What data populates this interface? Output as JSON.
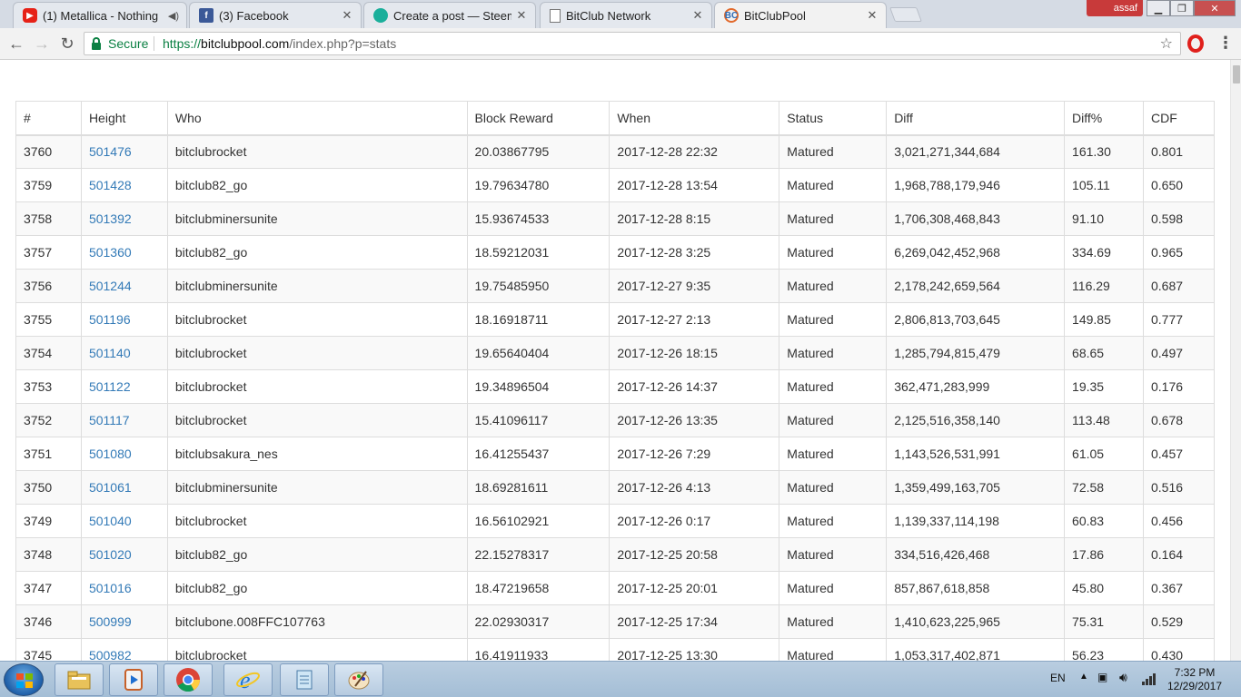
{
  "tabs": [
    {
      "title": "(1) Metallica - Nothing",
      "icon": "youtube-icon",
      "muted": true
    },
    {
      "title": "(3) Facebook",
      "icon": "facebook-icon"
    },
    {
      "title": "Create a post — Steemit",
      "icon": "steemit-icon"
    },
    {
      "title": "BitClub Network",
      "icon": "document-icon"
    },
    {
      "title": "BitClubPool",
      "icon": "bitclub-icon",
      "active": true
    }
  ],
  "window": {
    "user": "assaf"
  },
  "omnibox": {
    "secure_label": "Secure",
    "url_scheme": "https://",
    "url_host": "bitclubpool.com",
    "url_path": "/index.php?p=stats"
  },
  "table": {
    "headers": [
      "#",
      "Height",
      "Who",
      "Block Reward",
      "When",
      "Status",
      "Diff",
      "Diff%",
      "CDF"
    ],
    "rows": [
      [
        "3760",
        "501476",
        "bitclubrocket",
        "20.03867795",
        "2017-12-28 22:32",
        "Matured",
        "3,021,271,344,684",
        "161.30",
        "0.801"
      ],
      [
        "3759",
        "501428",
        "bitclub82_go",
        "19.79634780",
        "2017-12-28 13:54",
        "Matured",
        "1,968,788,179,946",
        "105.11",
        "0.650"
      ],
      [
        "3758",
        "501392",
        "bitclubminersunite",
        "15.93674533",
        "2017-12-28 8:15",
        "Matured",
        "1,706,308,468,843",
        "91.10",
        "0.598"
      ],
      [
        "3757",
        "501360",
        "bitclub82_go",
        "18.59212031",
        "2017-12-28 3:25",
        "Matured",
        "6,269,042,452,968",
        "334.69",
        "0.965"
      ],
      [
        "3756",
        "501244",
        "bitclubminersunite",
        "19.75485950",
        "2017-12-27 9:35",
        "Matured",
        "2,178,242,659,564",
        "116.29",
        "0.687"
      ],
      [
        "3755",
        "501196",
        "bitclubrocket",
        "18.16918711",
        "2017-12-27 2:13",
        "Matured",
        "2,806,813,703,645",
        "149.85",
        "0.777"
      ],
      [
        "3754",
        "501140",
        "bitclubrocket",
        "19.65640404",
        "2017-12-26 18:15",
        "Matured",
        "1,285,794,815,479",
        "68.65",
        "0.497"
      ],
      [
        "3753",
        "501122",
        "bitclubrocket",
        "19.34896504",
        "2017-12-26 14:37",
        "Matured",
        "362,471,283,999",
        "19.35",
        "0.176"
      ],
      [
        "3752",
        "501117",
        "bitclubrocket",
        "15.41096117",
        "2017-12-26 13:35",
        "Matured",
        "2,125,516,358,140",
        "113.48",
        "0.678"
      ],
      [
        "3751",
        "501080",
        "bitclubsakura_nes",
        "16.41255437",
        "2017-12-26 7:29",
        "Matured",
        "1,143,526,531,991",
        "61.05",
        "0.457"
      ],
      [
        "3750",
        "501061",
        "bitclubminersunite",
        "18.69281611",
        "2017-12-26 4:13",
        "Matured",
        "1,359,499,163,705",
        "72.58",
        "0.516"
      ],
      [
        "3749",
        "501040",
        "bitclubrocket",
        "16.56102921",
        "2017-12-26 0:17",
        "Matured",
        "1,139,337,114,198",
        "60.83",
        "0.456"
      ],
      [
        "3748",
        "501020",
        "bitclub82_go",
        "22.15278317",
        "2017-12-25 20:58",
        "Matured",
        "334,516,426,468",
        "17.86",
        "0.164"
      ],
      [
        "3747",
        "501016",
        "bitclub82_go",
        "18.47219658",
        "2017-12-25 20:01",
        "Matured",
        "857,867,618,858",
        "45.80",
        "0.367"
      ],
      [
        "3746",
        "500999",
        "bitclubone.008FFC107763",
        "22.02930317",
        "2017-12-25 17:34",
        "Matured",
        "1,410,623,225,965",
        "75.31",
        "0.529"
      ],
      [
        "3745",
        "500982",
        "bitclubrocket",
        "16.41911933",
        "2017-12-25 13:30",
        "Matured",
        "1,053,317,402,871",
        "56.23",
        "0.430"
      ]
    ]
  },
  "taskbar": {
    "apps": [
      "explorer-icon",
      "media-player-icon",
      "chrome-icon",
      "internet-explorer-icon",
      "notepad-icon",
      "paint-icon"
    ],
    "language": "EN",
    "time": "7:32 PM",
    "date": "12/29/2017"
  }
}
